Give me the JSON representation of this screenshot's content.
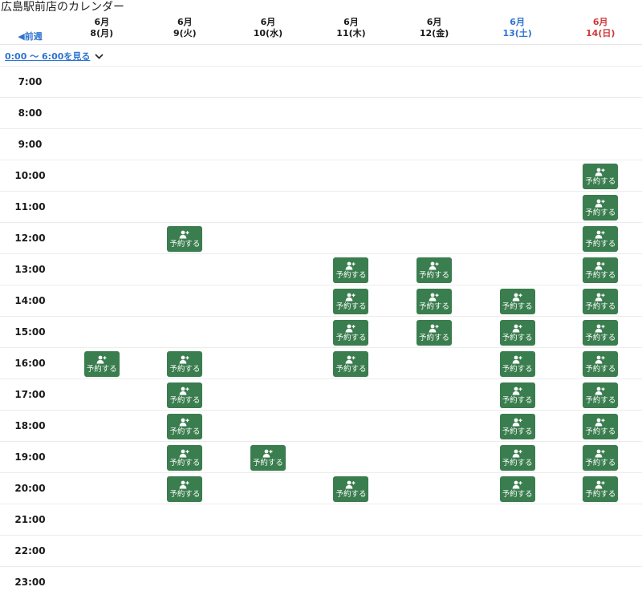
{
  "page_title": "広島駅前店のカレンダー",
  "nav": {
    "prev_week": "◀前週"
  },
  "early_toggle": {
    "label": "0:00 〜 6:00を見る",
    "icon": "chevron-down-icon"
  },
  "days": [
    {
      "month": "6月",
      "date": "8(月)",
      "type": "weekday"
    },
    {
      "month": "6月",
      "date": "9(火)",
      "type": "weekday"
    },
    {
      "month": "6月",
      "date": "10(水)",
      "type": "weekday"
    },
    {
      "month": "6月",
      "date": "11(木)",
      "type": "weekday"
    },
    {
      "month": "6月",
      "date": "12(金)",
      "type": "weekday"
    },
    {
      "month": "6月",
      "date": "13(土)",
      "type": "sat"
    },
    {
      "month": "6月",
      "date": "14(日)",
      "type": "sun"
    }
  ],
  "reserve_label": "予約する",
  "colors": {
    "accent_blue": "#2f74d0",
    "sunday_red": "#d0393b",
    "button_green": "#3a7d4e"
  },
  "rows": [
    {
      "time": "7:00",
      "slots": [
        0,
        0,
        0,
        0,
        0,
        0,
        0
      ]
    },
    {
      "time": "8:00",
      "slots": [
        0,
        0,
        0,
        0,
        0,
        0,
        0
      ]
    },
    {
      "time": "9:00",
      "slots": [
        0,
        0,
        0,
        0,
        0,
        0,
        0
      ]
    },
    {
      "time": "10:00",
      "slots": [
        0,
        0,
        0,
        0,
        0,
        0,
        1
      ]
    },
    {
      "time": "11:00",
      "slots": [
        0,
        0,
        0,
        0,
        0,
        0,
        1
      ]
    },
    {
      "time": "12:00",
      "slots": [
        0,
        1,
        0,
        0,
        0,
        0,
        1
      ]
    },
    {
      "time": "13:00",
      "slots": [
        0,
        0,
        0,
        1,
        1,
        0,
        1
      ]
    },
    {
      "time": "14:00",
      "slots": [
        0,
        0,
        0,
        1,
        1,
        1,
        1
      ]
    },
    {
      "time": "15:00",
      "slots": [
        0,
        0,
        0,
        1,
        1,
        1,
        1
      ]
    },
    {
      "time": "16:00",
      "slots": [
        1,
        1,
        0,
        1,
        0,
        1,
        1
      ]
    },
    {
      "time": "17:00",
      "slots": [
        0,
        1,
        0,
        0,
        0,
        1,
        1
      ]
    },
    {
      "time": "18:00",
      "slots": [
        0,
        1,
        0,
        0,
        0,
        1,
        1
      ]
    },
    {
      "time": "19:00",
      "slots": [
        0,
        1,
        1,
        0,
        0,
        1,
        1
      ]
    },
    {
      "time": "20:00",
      "slots": [
        0,
        1,
        0,
        1,
        0,
        1,
        1
      ]
    },
    {
      "time": "21:00",
      "slots": [
        0,
        0,
        0,
        0,
        0,
        0,
        0
      ]
    },
    {
      "time": "22:00",
      "slots": [
        0,
        0,
        0,
        0,
        0,
        0,
        0
      ]
    },
    {
      "time": "23:00",
      "slots": [
        0,
        0,
        0,
        0,
        0,
        0,
        0
      ]
    }
  ]
}
